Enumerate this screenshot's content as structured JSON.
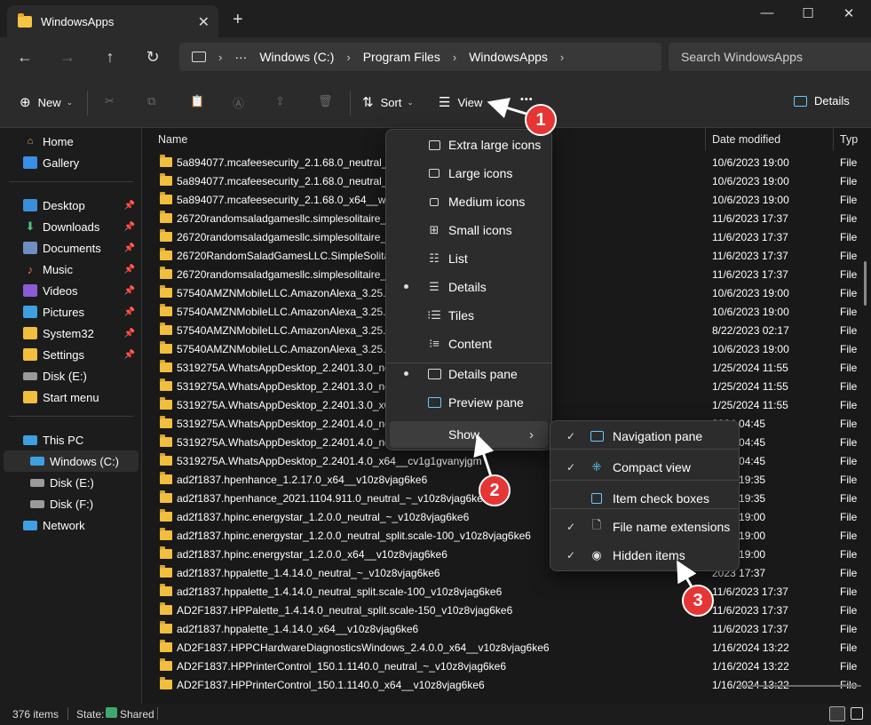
{
  "titlebar": {
    "tab_title": "WindowsApps",
    "close_tab": "✕",
    "new_tab": "+",
    "minimize": "—",
    "maximize": "☐",
    "close": "✕"
  },
  "nav": {
    "back": "←",
    "forward": "→",
    "up": "↑",
    "refresh": "↻",
    "breadcrumb": [
      "Windows (C:)",
      "Program Files",
      "WindowsApps"
    ],
    "ellipsis": "···",
    "search_placeholder": "Search WindowsApps"
  },
  "toolbar": {
    "new_label": "New",
    "sort_label": "Sort",
    "view_label": "View",
    "more_label": "•••",
    "details_label": "Details"
  },
  "sidebar": {
    "quick": [
      {
        "label": "Home",
        "icon": "home-icon",
        "pinned": false
      },
      {
        "label": "Gallery",
        "icon": "gallery-icon",
        "pinned": false
      }
    ],
    "pinned": [
      {
        "label": "Desktop",
        "icon": "desktop-icon"
      },
      {
        "label": "Downloads",
        "icon": "downloads-icon"
      },
      {
        "label": "Documents",
        "icon": "documents-icon"
      },
      {
        "label": "Music",
        "icon": "music-icon"
      },
      {
        "label": "Videos",
        "icon": "videos-icon"
      },
      {
        "label": "Pictures",
        "icon": "pictures-icon"
      },
      {
        "label": "System32",
        "icon": "folder-icon"
      },
      {
        "label": "Settings",
        "icon": "folder-icon"
      },
      {
        "label": "Disk (E:)",
        "icon": "drive-icon"
      },
      {
        "label": "Start menu",
        "icon": "folder-icon"
      }
    ],
    "this_pc": "This PC",
    "drives": [
      "Windows (C:)",
      "Disk (E:)",
      "Disk (F:)"
    ],
    "network": "Network",
    "pin_glyph": "📌"
  },
  "columns": {
    "name": "Name",
    "date": "Date modified",
    "type": "Typ"
  },
  "files": [
    {
      "name": "5a894077.mcafeesecurity_2.1.68.0_neutral_~_",
      "date": "10/6/2023 19:00",
      "type": "File"
    },
    {
      "name": "5a894077.mcafeesecurity_2.1.68.0_neutral_sp",
      "date": "10/6/2023 19:00",
      "type": "File"
    },
    {
      "name": "5a894077.mcafeesecurity_2.1.68.0_x64__wafk",
      "date": "10/6/2023 19:00",
      "type": "File"
    },
    {
      "name": "26720randomsaladgamesllc.simplesolitaire_7",
      "date": "11/6/2023 17:37",
      "type": "File"
    },
    {
      "name": "26720randomsaladgamesllc.simplesolitaire_7                                    dqmazqk8j",
      "date": "11/6/2023 17:37",
      "type": "File"
    },
    {
      "name": "26720RandomSaladGamesLLC.SimpleSolitair                                    24dqmazqk8j",
      "date": "11/6/2023 17:37",
      "type": "File"
    },
    {
      "name": "26720randomsaladgamesllc.simplesolitaire_7",
      "date": "11/6/2023 17:37",
      "type": "File"
    },
    {
      "name": "57540AMZNMobileLLC.AmazonAlexa_3.25.1",
      "date": "10/6/2023 19:00",
      "type": "File"
    },
    {
      "name": "57540AMZNMobileLLC.AmazonAlexa_3.25.1                                    sebte08",
      "date": "10/6/2023 19:00",
      "type": "File"
    },
    {
      "name": "57540AMZNMobileLLC.AmazonAlexa_3.25.1                                    sebte08",
      "date": "8/22/2023 02:17",
      "type": "File"
    },
    {
      "name": "57540AMZNMobileLLC.AmazonAlexa_3.25.1",
      "date": "10/6/2023 19:00",
      "type": "File"
    },
    {
      "name": "5319275A.WhatsAppDesktop_2.2401.3.0_neut",
      "date": "1/25/2024 11:55",
      "type": "File"
    },
    {
      "name": "5319275A.WhatsAppDesktop_2.2401.3.0_neut",
      "date": "1/25/2024 11:55",
      "type": "File"
    },
    {
      "name": "5319275A.WhatsAppDesktop_2.2401.3.0_x64",
      "date": "1/25/2024 11:55",
      "type": "File"
    },
    {
      "name": "5319275A.WhatsAppDesktop_2.2401.4.0_neut",
      "date": "2024 04:45",
      "type": "File"
    },
    {
      "name": "5319275A.WhatsAppDesktop_2.2401.4.0_neut",
      "date": "2024 04:45",
      "type": "File"
    },
    {
      "name": "5319275A.WhatsAppDesktop_2.2401.4.0_x64__cv1g1gvanyjgm",
      "date": "2024 04:45",
      "type": "File"
    },
    {
      "name": "ad2f1837.hpenhance_1.2.17.0_x64__v10z8vjag6ke6",
      "date": "2024 19:35",
      "type": "File"
    },
    {
      "name": "ad2f1837.hpenhance_2021.1104.911.0_neutral_~_v10z8vjag6ke6",
      "date": "2024 19:35",
      "type": "File"
    },
    {
      "name": "ad2f1837.hpinc.energystar_1.2.0.0_neutral_~_v10z8vjag6ke6",
      "date": "2023 19:00",
      "type": "File"
    },
    {
      "name": "ad2f1837.hpinc.energystar_1.2.0.0_neutral_split.scale-100_v10z8vjag6ke6",
      "date": "2023 19:00",
      "type": "File"
    },
    {
      "name": "ad2f1837.hpinc.energystar_1.2.0.0_x64__v10z8vjag6ke6",
      "date": "2023 19:00",
      "type": "File"
    },
    {
      "name": "ad2f1837.hppalette_1.4.14.0_neutral_~_v10z8vjag6ke6",
      "date": "2023 17:37",
      "type": "File"
    },
    {
      "name": "ad2f1837.hppalette_1.4.14.0_neutral_split.scale-100_v10z8vjag6ke6",
      "date": "11/6/2023 17:37",
      "type": "File"
    },
    {
      "name": "AD2F1837.HPPalette_1.4.14.0_neutral_split.scale-150_v10z8vjag6ke6",
      "date": "11/6/2023 17:37",
      "type": "File"
    },
    {
      "name": "ad2f1837.hppalette_1.4.14.0_x64__v10z8vjag6ke6",
      "date": "11/6/2023 17:37",
      "type": "File"
    },
    {
      "name": "AD2F1837.HPPCHardwareDiagnosticsWindows_2.4.0.0_x64__v10z8vjag6ke6",
      "date": "1/16/2024 13:22",
      "type": "File"
    },
    {
      "name": "AD2F1837.HPPrinterControl_150.1.1140.0_neutral_~_v10z8vjag6ke6",
      "date": "1/16/2024 13:22",
      "type": "File"
    },
    {
      "name": "AD2F1837.HPPrinterControl_150.1.1140.0_x64__v10z8vjag6ke6",
      "date": "1/16/2024 13:22",
      "type": "File"
    }
  ],
  "view_menu": {
    "items": [
      {
        "label": "Extra large icons",
        "icon": "extra-large-icons-icon",
        "selected": false
      },
      {
        "label": "Large icons",
        "icon": "large-icons-icon",
        "selected": false
      },
      {
        "label": "Medium icons",
        "icon": "medium-icons-icon",
        "selected": false
      },
      {
        "label": "Small icons",
        "icon": "small-icons-icon",
        "selected": false
      },
      {
        "label": "List",
        "icon": "list-icon",
        "selected": false
      },
      {
        "label": "Details",
        "icon": "details-icon",
        "selected": true
      },
      {
        "label": "Tiles",
        "icon": "tiles-icon",
        "selected": false
      },
      {
        "label": "Content",
        "icon": "content-icon",
        "selected": false
      }
    ],
    "panes": [
      {
        "label": "Details pane",
        "icon": "details-pane-icon",
        "selected": true
      },
      {
        "label": "Preview pane",
        "icon": "preview-pane-icon",
        "selected": false
      }
    ],
    "show_label": "Show",
    "show_chevron": "›"
  },
  "show_menu": {
    "items": [
      {
        "label": "Navigation pane",
        "icon": "navigation-pane-icon",
        "checked": true
      },
      {
        "label": "Compact view",
        "icon": "compact-view-icon",
        "checked": true
      },
      {
        "label": "Item check boxes",
        "icon": "item-check-boxes-icon",
        "checked": false
      },
      {
        "label": "File name extensions",
        "icon": "file-extensions-icon",
        "checked": true
      },
      {
        "label": "Hidden items",
        "icon": "hidden-items-icon",
        "checked": true
      }
    ],
    "check_glyph": "✓"
  },
  "annotations": [
    "1",
    "2",
    "3"
  ],
  "status": {
    "count": "376 items",
    "state_label": "State:",
    "state_value": "Shared"
  },
  "colors": {
    "accent": "#60cdff",
    "annotation": "#e53535",
    "folder": "#f1be3e"
  }
}
